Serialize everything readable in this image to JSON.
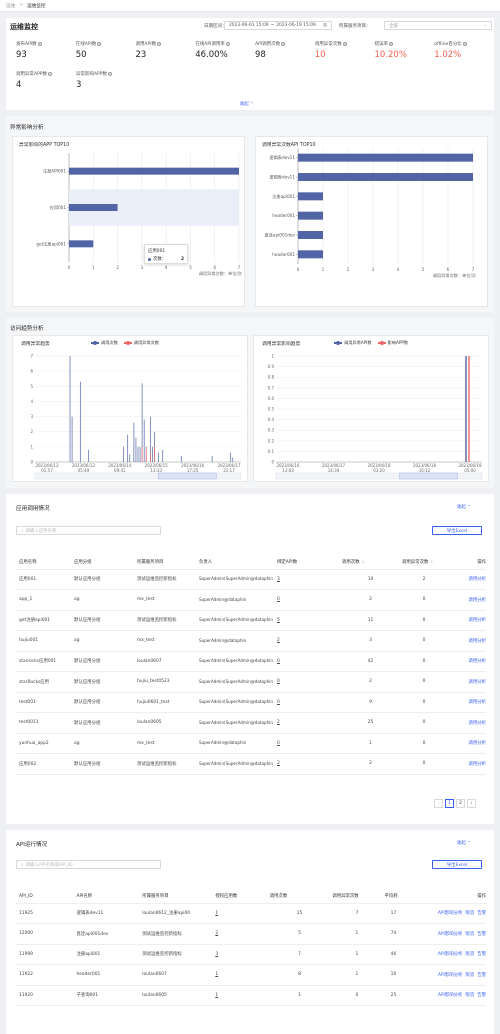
{
  "breadcrumb": {
    "parent": "运维",
    "sep": ">",
    "current": "运维监控"
  },
  "header": {
    "title": "运维监控",
    "date_label": "日期区间：",
    "date_start": "2023-06-01 15:09",
    "date_sep": "~",
    "date_end": "2023-06-19 15:09",
    "project_label": "所属服务项目：",
    "project_value": "全部"
  },
  "metrics_row1": [
    {
      "label": "发布API数",
      "value": "93",
      "red": false
    },
    {
      "label": "在线API数",
      "value": "50",
      "red": false
    },
    {
      "label": "调用API数",
      "value": "23",
      "red": false
    },
    {
      "label": "在线API调用率",
      "value": "46.00%",
      "red": false
    },
    {
      "label": "API调用次数",
      "value": "98",
      "red": false
    },
    {
      "label": "调用异常次数",
      "value": "10",
      "red": true
    },
    {
      "label": "错误率",
      "value": "10.20%",
      "red": true
    },
    {
      "label": "offline百分比",
      "value": "1.02%",
      "red": true
    }
  ],
  "metrics_row2": [
    {
      "label": "调用异常APP数",
      "value": "4"
    },
    {
      "label": "异常影响APP数",
      "value": "3"
    }
  ],
  "collapse_label": "收起",
  "section_exception": "异常影响分析",
  "app_top": {
    "title": "异常影响的APP TOP10",
    "categories": [
      "注册API001",
      "应用001",
      "get注册api001"
    ],
    "values": [
      7,
      2,
      1
    ],
    "xticks": [
      "0",
      "1",
      "2",
      "3",
      "4",
      "5",
      "6",
      "7"
    ],
    "axis_note": "调用异常次数：单位/次",
    "tooltip_title": "应用001",
    "tooltip_label": "次数：",
    "tooltip_value": "2",
    "bar_color": "#5164a6"
  },
  "api_top": {
    "title": "调用异常次数API TOP10",
    "categories": [
      "逻辑表dev11",
      "逻辑表dev11",
      "注册api001",
      "header001",
      "直连api001dev",
      "header001"
    ],
    "values": [
      7,
      7,
      1,
      1,
      1,
      1
    ],
    "xticks": [
      "0",
      "1",
      "2",
      "3",
      "4",
      "5",
      "6",
      "7"
    ],
    "axis_note": "调用异常次数：单位/次",
    "bar_color": "#5164a6"
  },
  "section_trend": "访问趋势分析",
  "trend_left": {
    "title": "调用异常趋势",
    "legend": [
      "调用次数",
      "调用异常次数"
    ],
    "colors": [
      "#5164a6",
      "#ee6666"
    ],
    "yticks": [
      "0",
      "1",
      "2",
      "3",
      "4",
      "5",
      "6",
      "7"
    ],
    "xticks": [
      "2023/06/12\n01:57",
      "2023/06/13\n05:49",
      "2023/06/14\n09:41",
      "2023/06/15\n13:33",
      "2023/06/16\n17:25",
      "2023/06/17\n21:17"
    ]
  },
  "trend_right": {
    "title": "调用异常影响趋势",
    "legend": [
      "调用异常API数",
      "影响APP数"
    ],
    "colors": [
      "#5164a6",
      "#ee6666"
    ],
    "yticks": [
      "0",
      "0.1",
      "0.2",
      "0.3",
      "0.4",
      "0.5",
      "0.6",
      "0.7",
      "0.8",
      "0.9",
      "1"
    ],
    "xticks": [
      "2023/06/16\n13:03",
      "2023/06/17\n14:39",
      "2023/06/18\n03:20",
      "2023/06/18\n16:12",
      "2023/06/19\n05:00"
    ]
  },
  "app_section": {
    "title": "应用调用情况",
    "collapse": "收起",
    "search_placeholder": "请输入应用名称",
    "export": "导出Excel",
    "columns": [
      "应用名称",
      "应用分组",
      "所属服务项目",
      "负责人",
      "绑定API数",
      "调用次数",
      "调用异常次数",
      "操作"
    ],
    "action": "调用分析",
    "rows": [
      [
        "应用001",
        "默认应用分组",
        "测试运维监控新指标",
        "SuperAdmin(SuperAdmin@dataphin",
        "3",
        "10",
        "2"
      ],
      [
        "app_1",
        "ag",
        "mx_test",
        "SuperAdmin@dataphin",
        "0",
        "2",
        "0"
      ],
      [
        "get注册api001",
        "默认应用分组",
        "测试运维监控新指标",
        "SuperAdmin(SuperAdmin@dataphin",
        "5",
        "11",
        "0"
      ],
      [
        "hujiu001",
        "ag",
        "mx_test",
        "SuperAdmin@dataphin",
        "2",
        "3",
        "0"
      ],
      [
        "starrocks应用001",
        "默认应用分组",
        "loulan0607",
        "SuperAdmin(SuperAdmin@dataphin",
        "0",
        "42",
        "0"
      ],
      [
        "starRocks应用",
        "默认应用分组",
        "hujiu_test0523",
        "SuperAdmin(SuperAdmin@dataphin",
        "0",
        "2",
        "0"
      ],
      [
        "test001",
        "默认应用分组",
        "hujiu0601_test",
        "SuperAdmin(SuperAdmin@dataphin",
        "0",
        "9",
        "0"
      ],
      [
        "test0011",
        "默认应用分组",
        "loulan0605",
        "SuperAdmin(SuperAdmin@dataphin",
        "2",
        "25",
        "0"
      ],
      [
        "yunhua_app2",
        "ag",
        "mx_test",
        "SuperAdmin@dataphin",
        "0",
        "1",
        "0"
      ],
      [
        "应用002",
        "默认应用分组",
        "测试运维监控新指标",
        "SuperAdmin(SuperAdmin@dataphin",
        "2",
        "2",
        "0"
      ]
    ],
    "pages": [
      "1",
      "2"
    ]
  },
  "api_section": {
    "title": "API运行情况",
    "collapse": "收起",
    "search_placeholder": "请输入API名称或API_ID",
    "export": "导出Excel",
    "columns": [
      "API_ID",
      "API名称",
      "所属服务项目",
      "授权应用数",
      "调用次数",
      "调用异常次数",
      "平均耗",
      "操作"
    ],
    "actions": [
      "API影响分析",
      "限流",
      "告警"
    ],
    "rows": [
      [
        "11925",
        "逻辑表dev11",
        "loulan0612_注册api00",
        "1",
        "15",
        "7",
        "17"
      ],
      [
        "12000",
        "直连api001dev",
        "测试运维监控新指标",
        "2",
        "5",
        "1",
        "74"
      ],
      [
        "11999",
        "注册api001",
        "测试运维监控新指标",
        "3",
        "7",
        "1",
        "46"
      ],
      [
        "11922",
        "header001",
        "loulan0607",
        "1",
        "8",
        "1",
        "10"
      ],
      [
        "11920",
        "子查询001",
        "loulan0605",
        "1",
        "1",
        "0",
        "25"
      ]
    ]
  }
}
